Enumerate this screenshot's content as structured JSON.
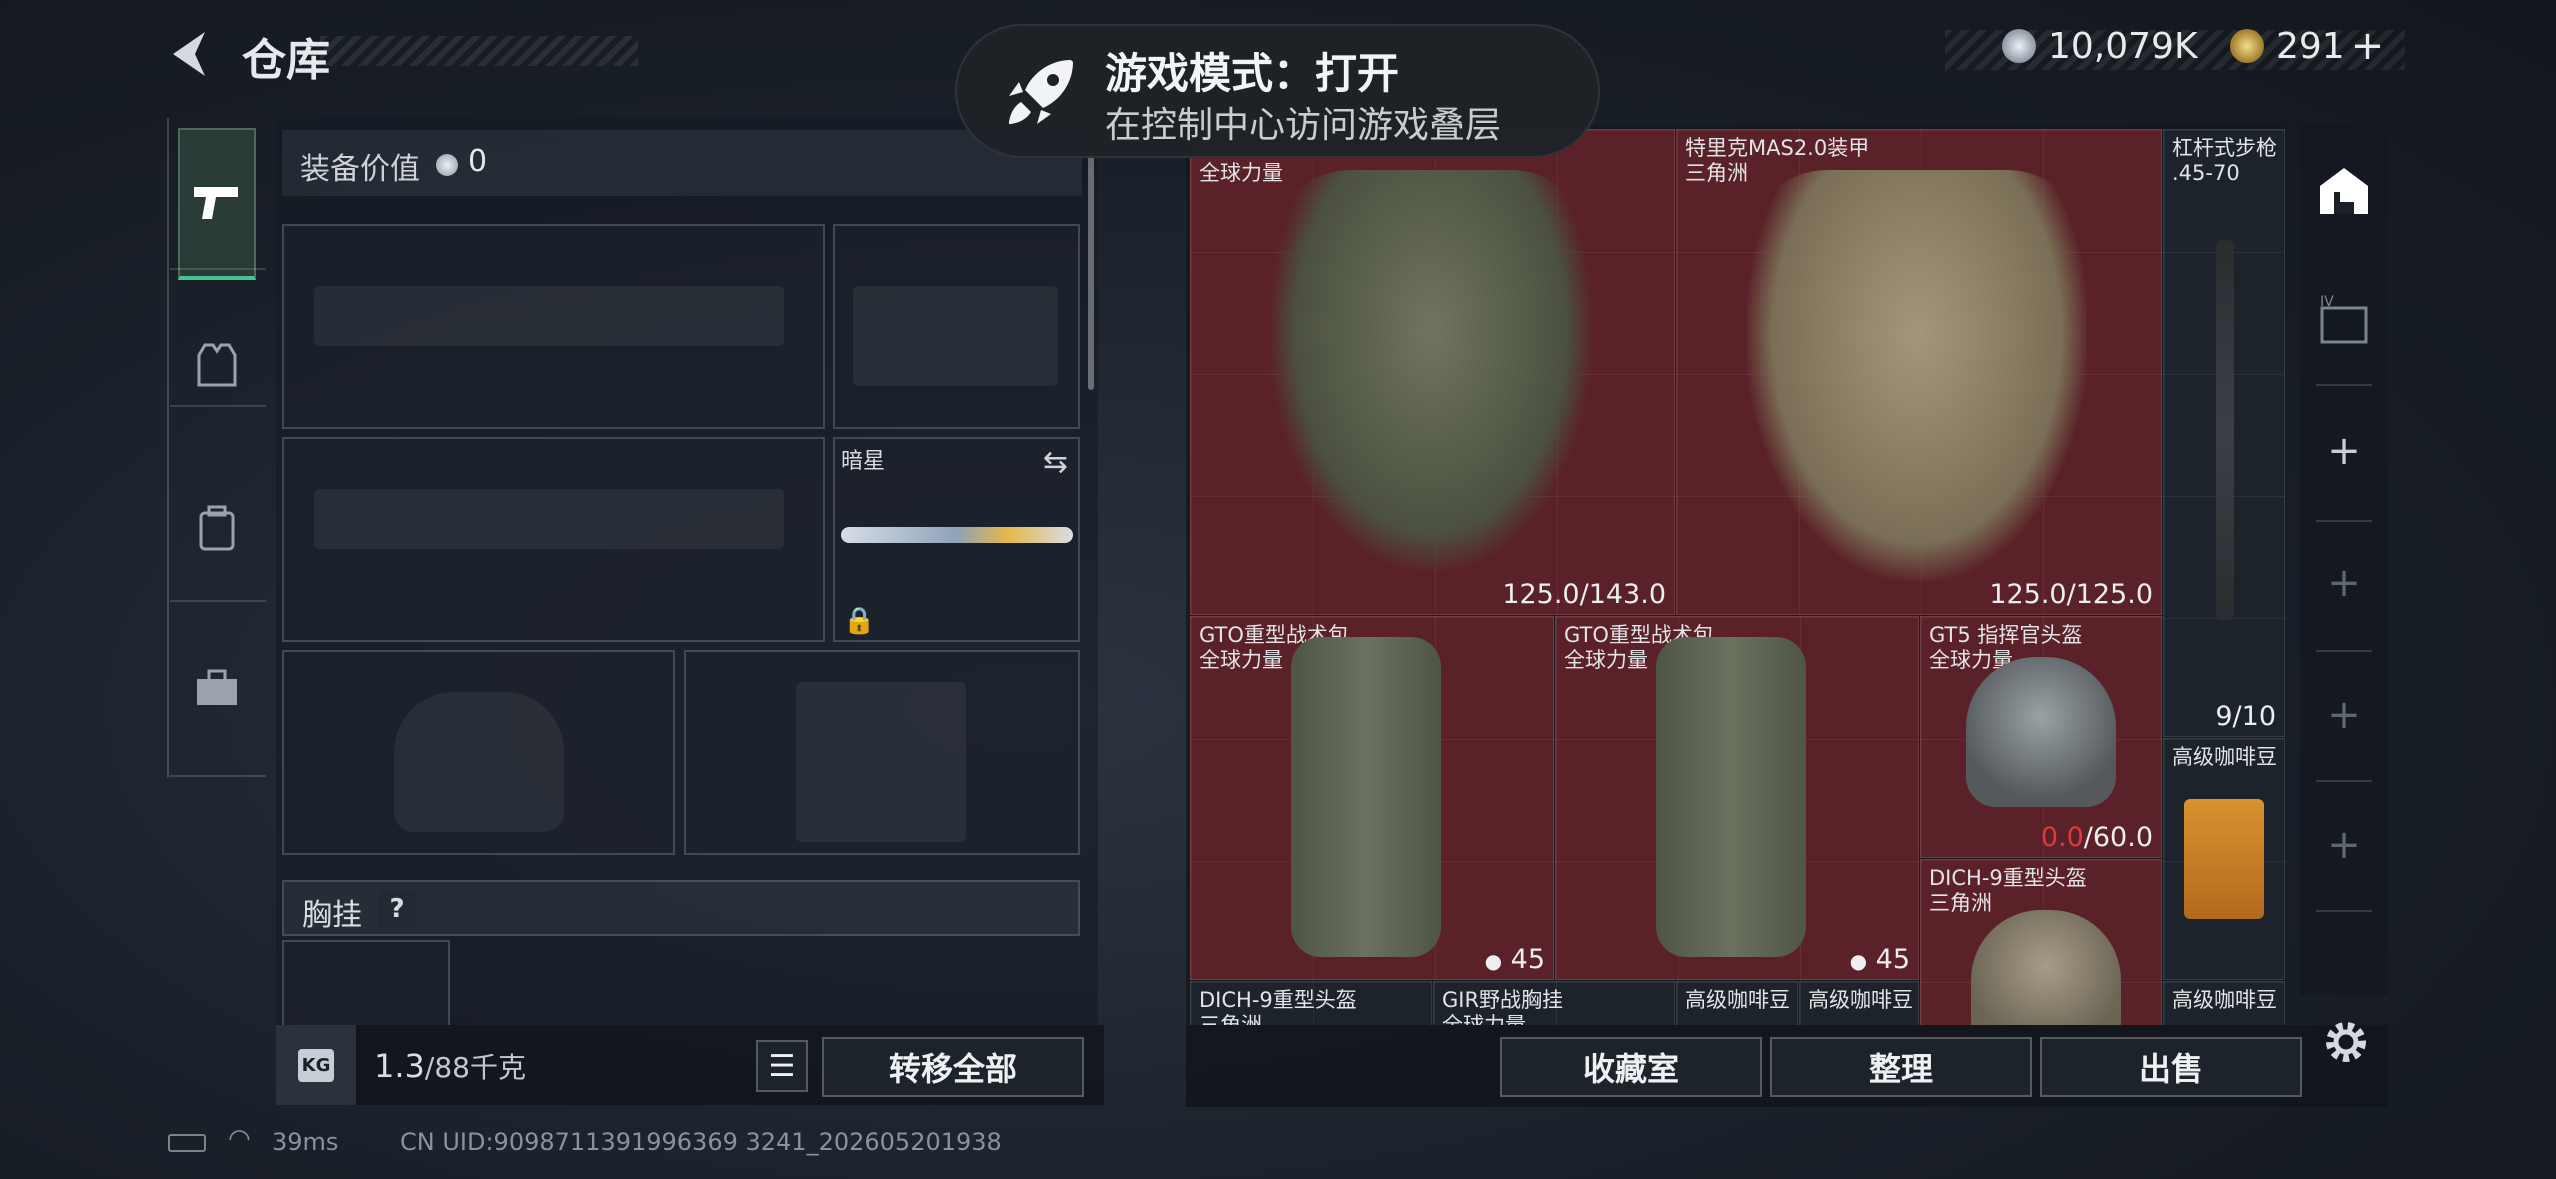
{
  "header": {
    "title": "仓库"
  },
  "currency": {
    "silver": "10,079K",
    "gold": "291",
    "gold_add": "+"
  },
  "toast": {
    "title": "游戏模式：打开",
    "subtitle": "在控制中心访问游戏叠层"
  },
  "equipment": {
    "value_label": "装备价值",
    "value": "0",
    "knife_name": "暗星",
    "chest_rig_label": "胸挂",
    "help": "?"
  },
  "bottom": {
    "kg_icon": "KG",
    "weight": "1.3",
    "capacity": "/88千克",
    "transfer_all": "转移全部"
  },
  "items": [
    {
      "name": "",
      "sub": "全球力量",
      "value": "125.0/143.0"
    },
    {
      "name": "特里克MAS2.0装甲",
      "sub": "三角洲",
      "value": "125.0/125.0"
    },
    {
      "name": "杠杆式步枪",
      "sub": ".45-70",
      "value": "9/10"
    },
    {
      "name": "GTO重型战术包",
      "sub": "全球力量",
      "value": "45"
    },
    {
      "name": "GTO重型战术包",
      "sub": "全球力量",
      "value": "45"
    },
    {
      "name": "GT5 指挥官头盔",
      "sub": "全球力量",
      "value_red": "0.0",
      "value": "/60.0"
    },
    {
      "name": "高级咖啡豆",
      "sub": "",
      "value": ""
    },
    {
      "name": "DICH-9重型头盔",
      "sub": "三角洲",
      "value": ""
    },
    {
      "name": "DICH-9重型头盔",
      "sub": "三角洲",
      "value": ""
    },
    {
      "name": "GIR野战胸挂",
      "sub": "全球力量",
      "value": ""
    },
    {
      "name": "高级咖啡豆",
      "sub": "",
      "value": ""
    },
    {
      "name": "高级咖啡豆",
      "sub": "",
      "value": ""
    },
    {
      "name": "高级咖啡豆",
      "sub": "",
      "value": ""
    }
  ],
  "actions": {
    "favorites": "收藏室",
    "organize": "整理",
    "sell": "出售"
  },
  "rail": {
    "plus": "+"
  },
  "status": {
    "ping": "39ms",
    "uid": "CN UID:9098711391996369 3241_202605201938"
  },
  "colors": {
    "accent_green": "#48c58e",
    "item_bg_red": "#5a2128",
    "durability_low": "#e0393a"
  }
}
